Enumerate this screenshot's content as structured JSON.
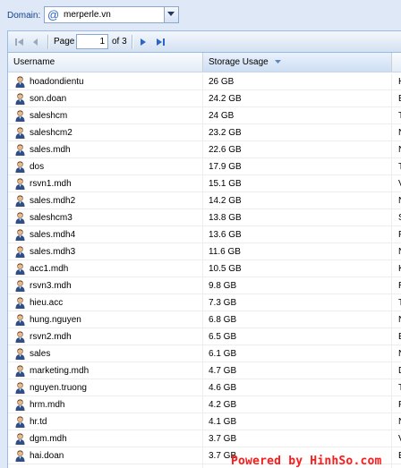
{
  "domain": {
    "label": "Domain:",
    "value": "merperle.vn"
  },
  "pager": {
    "page_label": "Page",
    "page_value": "1",
    "of_label": "of 3"
  },
  "columns": {
    "username": "Username",
    "storage": "Storage Usage",
    "third": ""
  },
  "icons": {
    "first": "first-page-icon",
    "prev": "prev-page-icon",
    "next": "next-page-icon",
    "last": "last-page-icon",
    "user": "user-icon",
    "sort": "sort-desc-icon"
  },
  "rows": [
    {
      "username": "hoadondientu",
      "storage": "26 GB",
      "col3": "H"
    },
    {
      "username": "son.doan",
      "storage": "24.2 GB",
      "col3": "E"
    },
    {
      "username": "saleshcm",
      "storage": "24 GB",
      "col3": "T"
    },
    {
      "username": "saleshcm2",
      "storage": "23.2 GB",
      "col3": "N"
    },
    {
      "username": "sales.mdh",
      "storage": "22.6 GB",
      "col3": "N"
    },
    {
      "username": "dos",
      "storage": "17.9 GB",
      "col3": "T"
    },
    {
      "username": "rsvn1.mdh",
      "storage": "15.1 GB",
      "col3": "V"
    },
    {
      "username": "sales.mdh2",
      "storage": "14.2 GB",
      "col3": "N"
    },
    {
      "username": "saleshcm3",
      "storage": "13.8 GB",
      "col3": "S"
    },
    {
      "username": "sales.mdh4",
      "storage": "13.6 GB",
      "col3": "F"
    },
    {
      "username": "sales.mdh3",
      "storage": "11.6 GB",
      "col3": "N"
    },
    {
      "username": "acc1.mdh",
      "storage": "10.5 GB",
      "col3": "K"
    },
    {
      "username": "rsvn3.mdh",
      "storage": "9.8 GB",
      "col3": "R"
    },
    {
      "username": "hieu.acc",
      "storage": "7.3 GB",
      "col3": "T"
    },
    {
      "username": "hung.nguyen",
      "storage": "6.8 GB",
      "col3": "N"
    },
    {
      "username": "rsvn2.mdh",
      "storage": "6.5 GB",
      "col3": "E"
    },
    {
      "username": "sales",
      "storage": "6.1 GB",
      "col3": "N"
    },
    {
      "username": "marketing.mdh",
      "storage": "4.7 GB",
      "col3": "D"
    },
    {
      "username": "nguyen.truong",
      "storage": "4.6 GB",
      "col3": "T"
    },
    {
      "username": "hrm.mdh",
      "storage": "4.2 GB",
      "col3": "F"
    },
    {
      "username": "hr.td",
      "storage": "4.1 GB",
      "col3": "N"
    },
    {
      "username": "dgm.mdh",
      "storage": "3.7 GB",
      "col3": "V"
    },
    {
      "username": "hai.doan",
      "storage": "3.7 GB",
      "col3": "E"
    }
  ],
  "watermark": "Powered by HinhSo.com"
}
